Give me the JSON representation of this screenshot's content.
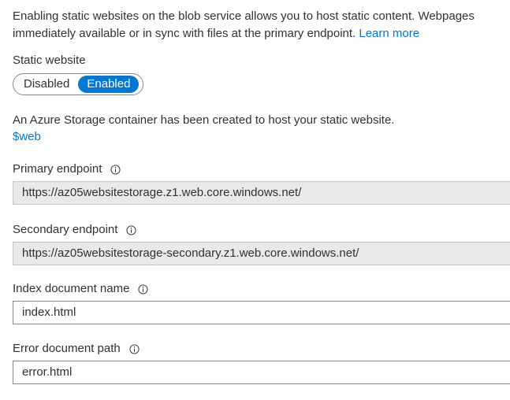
{
  "intro": {
    "line1": "Enabling static websites on the blob service allows you to host static content. Webpages",
    "line2": "immediately available or in sync with files at the primary endpoint.",
    "learn_more": "Learn more"
  },
  "static_website": {
    "label": "Static website",
    "options": [
      "Disabled",
      "Enabled"
    ],
    "selected": "Enabled"
  },
  "container_note": {
    "text": "An Azure Storage container has been created to host your static website.",
    "link": "$web"
  },
  "primary_endpoint": {
    "label": "Primary endpoint",
    "value": "https://az05websitestorage.z1.web.core.windows.net/"
  },
  "secondary_endpoint": {
    "label": "Secondary endpoint",
    "value": "https://az05websitestorage-secondary.z1.web.core.windows.net/"
  },
  "index_document": {
    "label": "Index document name",
    "value": "index.html"
  },
  "error_document": {
    "label": "Error document path",
    "value": "error.html"
  },
  "colors": {
    "accent": "#0078d4",
    "readonly_bg": "#e9e9e9",
    "border": "#8a8886",
    "text": "#323130"
  }
}
